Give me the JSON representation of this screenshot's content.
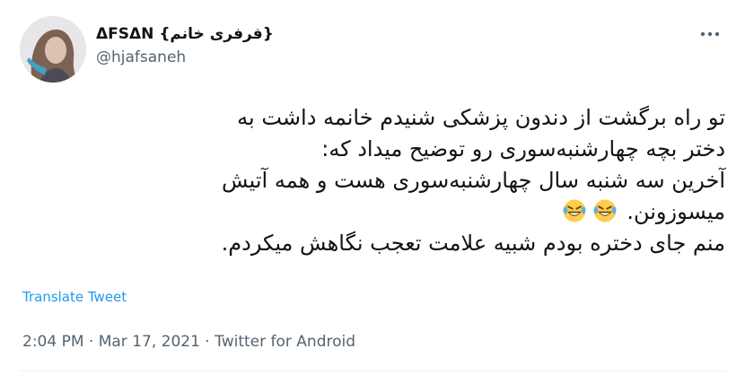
{
  "author": {
    "display_name": "ΔFSΔN {فرفری خانم}",
    "handle": "@hjafsaneh"
  },
  "tweet": {
    "lines": [
      "تو راه برگشت از دندون پزشکی شنیدم خانمه داشت به",
      "دختر بچه چهارشنبه‌سوری رو توضیح میداد که:",
      "آخرین سه شنبه سال چهارشنبه‌سوری هست و همه آتیش",
      "میسوزونن.",
      "منم جای دختره بودم شبیه علامت تعجب نگاهش میکردم."
    ],
    "emoji_icon": "rolling-on-the-floor-laughing-icon",
    "emoji_count": 2
  },
  "translate_label": "Translate Tweet",
  "meta": {
    "time": "2:04 PM",
    "separator": " · ",
    "date": "Mar 17, 2021",
    "source": "Twitter for Android"
  },
  "more_icon": "more-horizontal-icon",
  "colors": {
    "text": "#0f1419",
    "secondary": "#536471",
    "link": "#1d9bf0"
  }
}
